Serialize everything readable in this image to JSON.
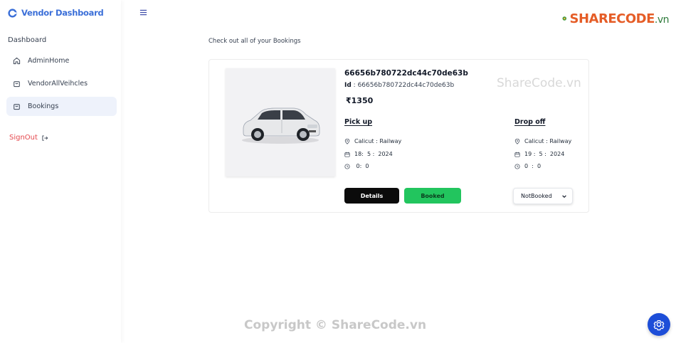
{
  "sidebar": {
    "brand_title": "Vendor Dashboard",
    "section_label": "Dashboard",
    "items": [
      {
        "label": "AdminHome",
        "icon": "home-icon",
        "active": false
      },
      {
        "label": "VendorAllVeihcles",
        "icon": "bag-icon",
        "active": false
      },
      {
        "label": "Bookings",
        "icon": "bag-icon",
        "active": true
      }
    ],
    "signout_label": "SignOut"
  },
  "header": {
    "menu_icon": "hamburger-icon"
  },
  "watermark": {
    "logo_text": "SHARECODE",
    "logo_suffix": ".vn",
    "center_text": "ShareCode.vn",
    "footer_text": "Copyright © ShareCode.vn"
  },
  "main": {
    "heading": "Check out all of your Bookings",
    "booking": {
      "title": "66656b780722dc44c70de63b",
      "id_label": "Id",
      "id_value": ": 66656b780722dc44c70de63b",
      "price": "₹1350",
      "pickup": {
        "heading": "Pick up",
        "location": "Calicut : Railway",
        "date": "18:  5 :  2024",
        "time": " 0:  0"
      },
      "dropoff": {
        "heading": "Drop off",
        "location": "Calicut : Railway",
        "date": "19 :  5 :  2024",
        "time": "0  :  0"
      },
      "details_label": "Details",
      "booked_label": "Booked",
      "status_select": "NotBooked"
    }
  },
  "colors": {
    "brand": "#3b6fd8",
    "signout": "#e5484d",
    "booked_button": "#22c55e",
    "details_button": "#0b0b0b",
    "fab": "#1d4ed8"
  }
}
